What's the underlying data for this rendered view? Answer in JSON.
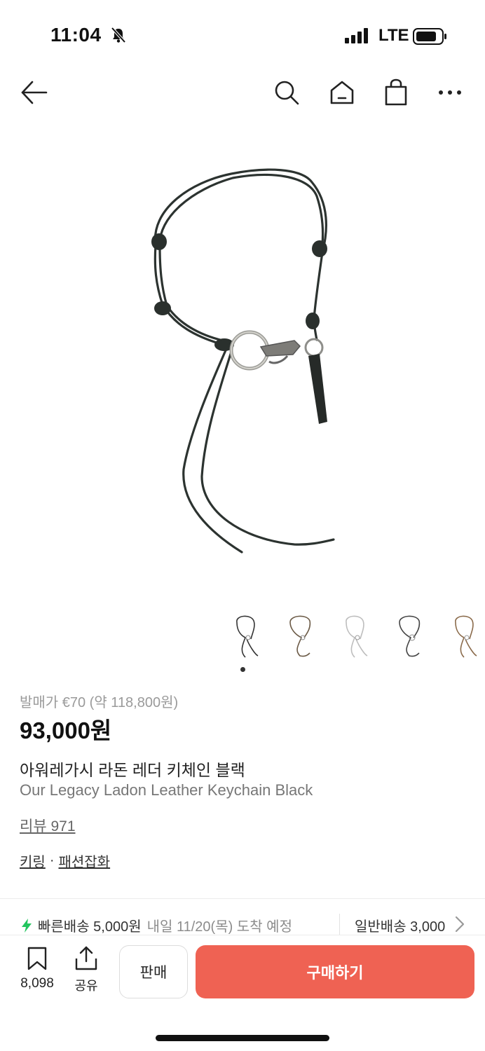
{
  "status_bar": {
    "time": "11:04",
    "network": "LTE"
  },
  "nav": {
    "back_icon": "arrow-left-icon",
    "search_icon": "search-icon",
    "home_icon": "home-icon",
    "cart_icon": "shopping-bag-icon",
    "more_icon": "more-dots-icon"
  },
  "product": {
    "retail_price": "발매가 €70 (약 118,800원)",
    "price": "93,000원",
    "name_ko": "아워레가시 라돈 레더 키체인 블랙",
    "name_en": "Our Legacy Ladon Leather Keychain Black",
    "review": "리뷰 971",
    "category_1": "키링",
    "category_sep": "·",
    "category_2": "패션잡화",
    "image_count": 5,
    "current_image": 1
  },
  "shipping": {
    "fast_label": "빠른배송 5,000원",
    "fast_eta": "내일 11/20(목) 도착 예정",
    "normal_label": "일반배송 3,000"
  },
  "bottom_bar": {
    "wish_count": "8,098",
    "share_label": "공유",
    "sell_label": "판매",
    "buy_label": "구매하기"
  },
  "colors": {
    "buy_button": "#ef6253",
    "fast_ship_bolt": "#22c55e"
  }
}
